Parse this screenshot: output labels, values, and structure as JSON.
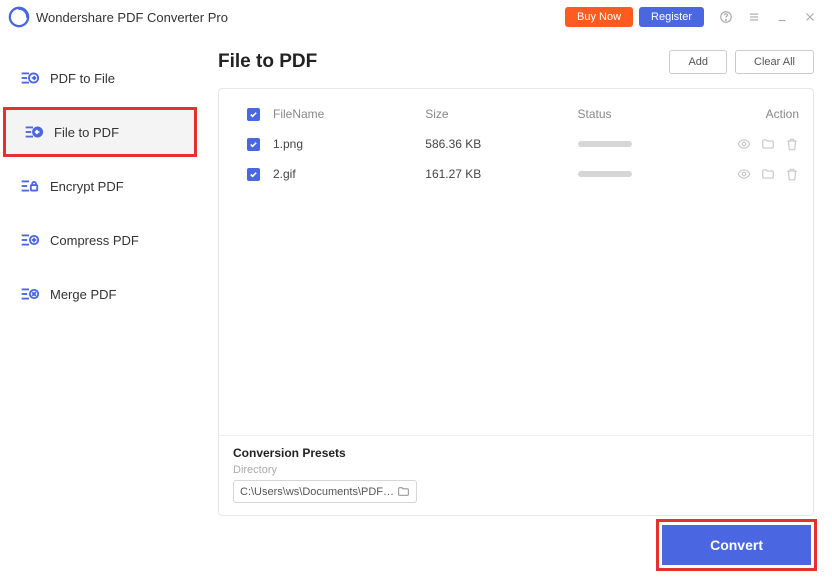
{
  "app": {
    "title": "Wondershare PDF Converter Pro"
  },
  "titlebar": {
    "buyNow": "Buy Now",
    "register": "Register"
  },
  "sidebar": {
    "items": [
      {
        "label": "PDF to File",
        "active": false
      },
      {
        "label": "File to PDF",
        "active": true
      },
      {
        "label": "Encrypt PDF",
        "active": false
      },
      {
        "label": "Compress PDF",
        "active": false
      },
      {
        "label": "Merge PDF",
        "active": false
      }
    ]
  },
  "page": {
    "title": "File to PDF",
    "addBtn": "Add",
    "clearAllBtn": "Clear All"
  },
  "table": {
    "headers": {
      "filename": "FileName",
      "size": "Size",
      "status": "Status",
      "action": "Action"
    },
    "rows": [
      {
        "checked": true,
        "name": "1.png",
        "size": "586.36 KB"
      },
      {
        "checked": true,
        "name": "2.gif",
        "size": "161.27 KB"
      }
    ]
  },
  "presets": {
    "title": "Conversion Presets",
    "directoryLabel": "Directory",
    "directory": "C:\\Users\\ws\\Documents\\PDFConvert"
  },
  "convert": {
    "label": "Convert"
  }
}
